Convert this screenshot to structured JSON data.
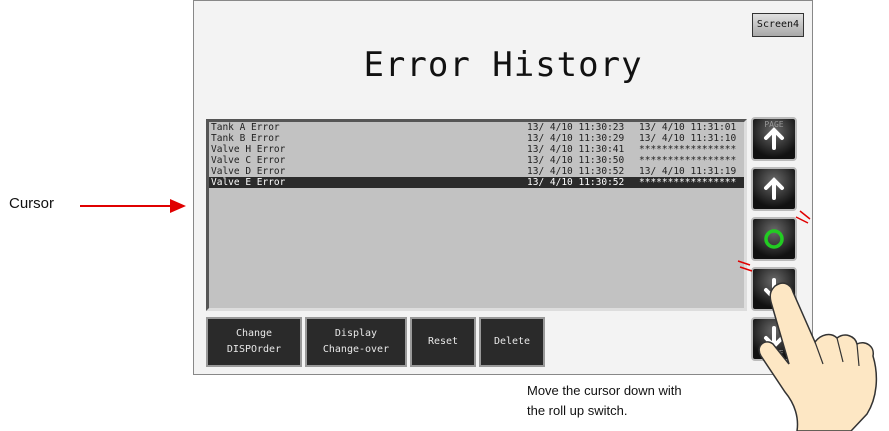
{
  "screen_button": "Screen4",
  "title": "Error History",
  "rows": [
    {
      "name": "Tank A Error",
      "t1": "13/ 4/10 11:30:23",
      "t2": "13/ 4/10 11:31:01"
    },
    {
      "name": "Tank B Error",
      "t1": "13/ 4/10 11:30:29",
      "t2": "13/ 4/10 11:31:10"
    },
    {
      "name": "Valve H Error",
      "t1": "13/ 4/10 11:30:41",
      "t2": "*****************"
    },
    {
      "name": "Valve C Error",
      "t1": "13/ 4/10 11:30:50",
      "t2": "*****************"
    },
    {
      "name": "Valve D Error",
      "t1": "13/ 4/10 11:30:52",
      "t2": "13/ 4/10 11:31:19"
    },
    {
      "name": "Valve E Error",
      "t1": "13/ 4/10 11:30:52",
      "t2": "*****************"
    }
  ],
  "buttons": {
    "change_line1": "Change",
    "change_line2": "DISPOrder",
    "display_line1": "Display",
    "display_line2": "Change-over",
    "reset": "Reset",
    "delete": "Delete"
  },
  "side": {
    "page_up": "PAGE",
    "page_down": "PAGE"
  },
  "annotations": {
    "cursor": "Cursor",
    "caption_line1": "Move the cursor down with",
    "caption_line2": "the roll up switch."
  },
  "colors": {
    "arrow_red": "#e00000",
    "circle_green": "#22cc22"
  }
}
